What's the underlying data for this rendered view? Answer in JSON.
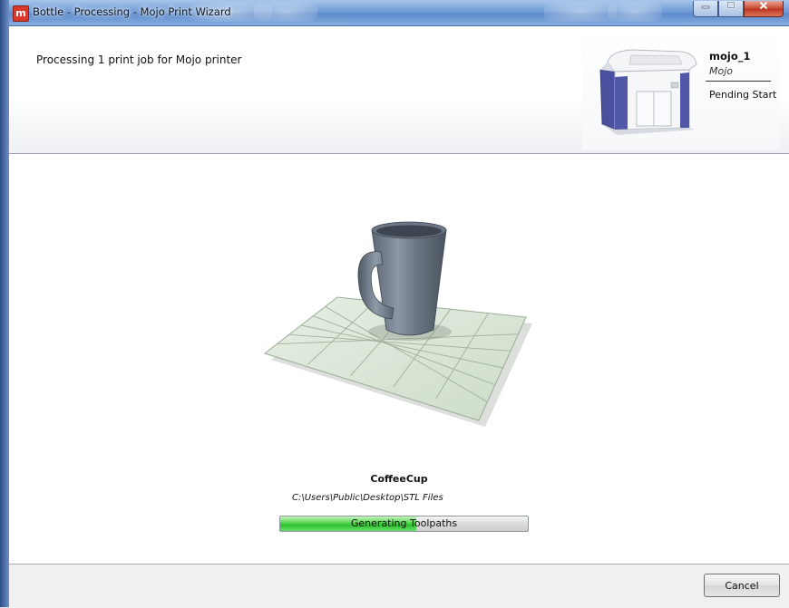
{
  "window": {
    "title": "Bottle - Processing - Mojo Print Wizard",
    "app_icon_letter": "m",
    "controls": {
      "minimize": "icon-minimize",
      "maximize": "icon-maximize",
      "close": "icon-close"
    }
  },
  "header": {
    "title": "Processing 1 print job for Mojo printer",
    "printer": {
      "name": "mojo_1",
      "model": "Mojo",
      "status": "Pending Start",
      "image_icon": "printer-icon"
    }
  },
  "job": {
    "file_name": "CoffeeCup",
    "file_path": "C:\\Users\\Public\\Desktop\\STL Files",
    "preview_icon": "coffee-cup-3d-model",
    "progress": {
      "label": "Generating Toolpaths",
      "fraction": 0.55
    }
  },
  "footer": {
    "cancel_label": "Cancel"
  },
  "colors": {
    "title_bar": "#6f9bd6",
    "progress_fill": "#2fbf2f",
    "build_plate": "#dbe8d7"
  }
}
